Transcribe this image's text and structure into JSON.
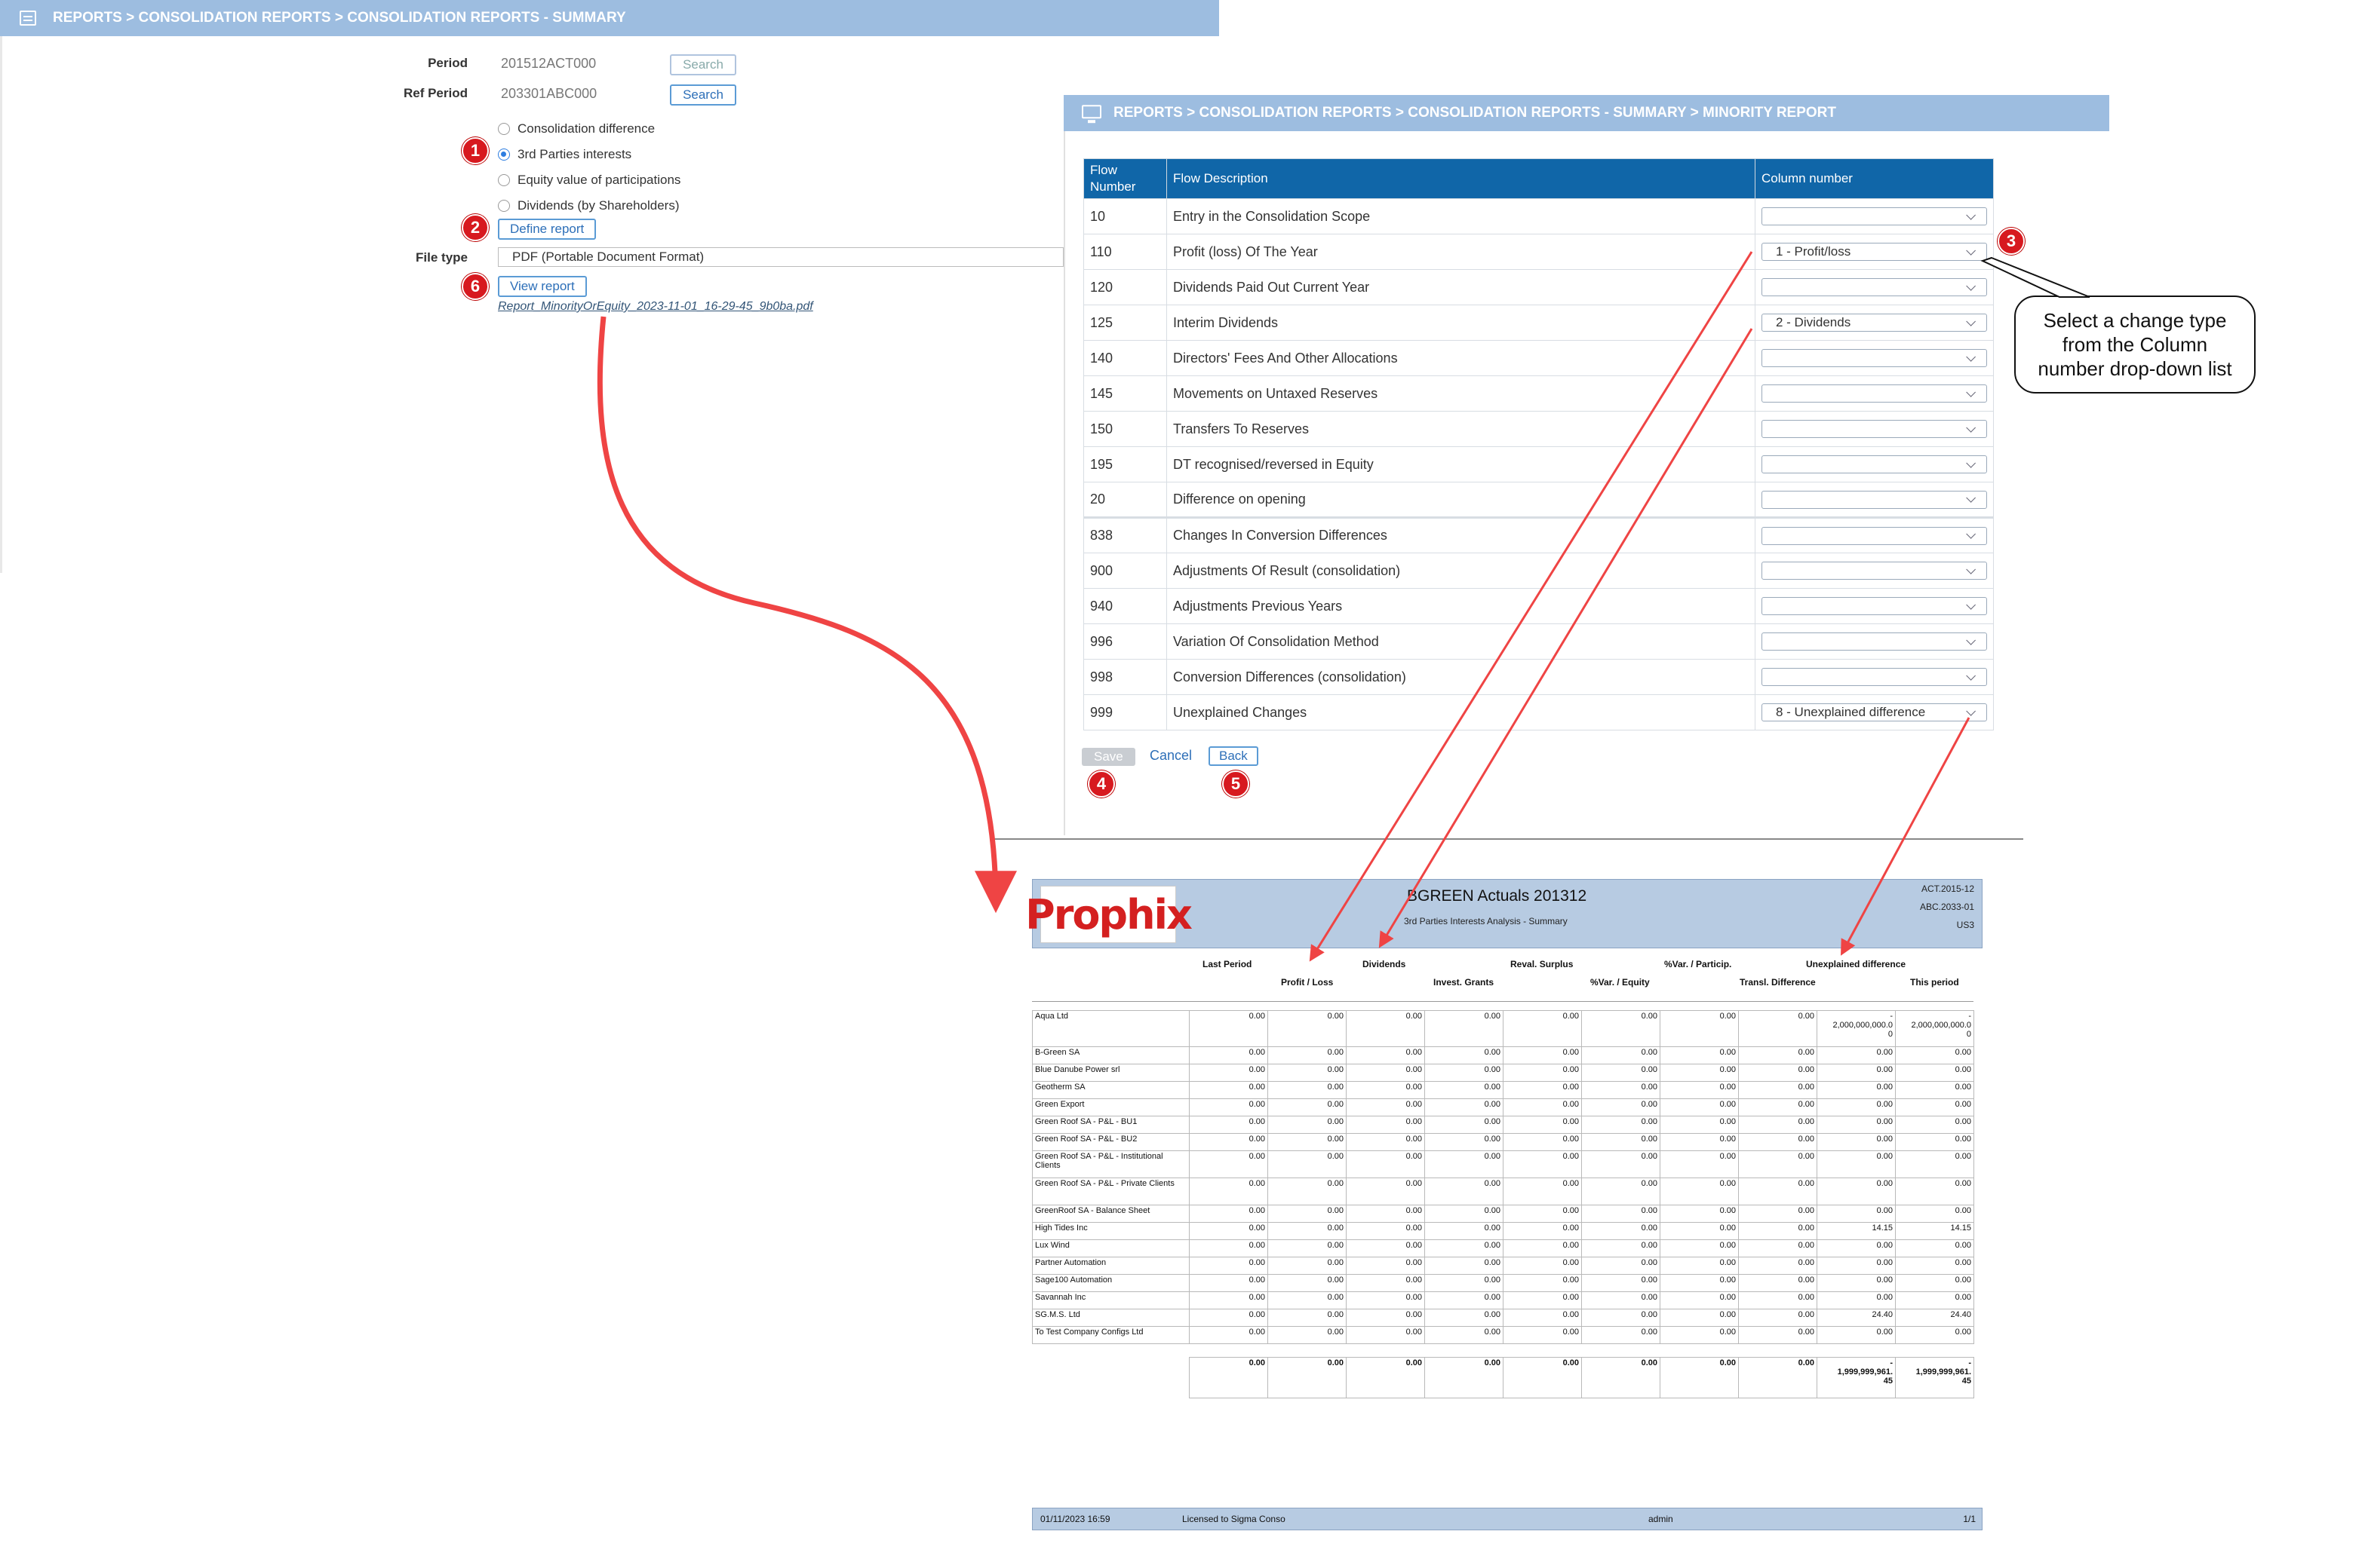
{
  "left_panel": {
    "breadcrumb": "REPORTS > CONSOLIDATION REPORTS > CONSOLIDATION REPORTS - SUMMARY",
    "period_label": "Period",
    "period_value": "201512ACT000",
    "ref_period_label": "Ref Period",
    "ref_period_value": "203301ABC000",
    "search_label": "Search",
    "report_types": [
      {
        "label": "Consolidation difference",
        "selected": false
      },
      {
        "label": "3rd Parties interests",
        "selected": true
      },
      {
        "label": "Equity value of participations",
        "selected": false
      },
      {
        "label": "Dividends (by Shareholders)",
        "selected": false
      }
    ],
    "define_report_label": "Define report",
    "file_type_label": "File type",
    "file_type_value": "PDF (Portable Document Format)",
    "view_report_label": "View report",
    "file_link": "Report_MinorityOrEquity_2023-11-01_16-29-45_9b0ba.pdf"
  },
  "badges": [
    "1",
    "2",
    "6",
    "3",
    "4",
    "5"
  ],
  "minority_report": {
    "breadcrumb": "REPORTS > CONSOLIDATION REPORTS > CONSOLIDATION REPORTS - SUMMARY > MINORITY REPORT",
    "columns": [
      "Flow Number",
      "Flow Description",
      "Column number"
    ],
    "rows": [
      {
        "number": "10",
        "description": "Entry in the Consolidation Scope",
        "column": ""
      },
      {
        "number": "110",
        "description": "Profit (loss) Of The Year",
        "column": "1 - Profit/loss"
      },
      {
        "number": "120",
        "description": "Dividends Paid Out Current Year",
        "column": ""
      },
      {
        "number": "125",
        "description": "Interim Dividends",
        "column": "2 - Dividends"
      },
      {
        "number": "140",
        "description": "Directors' Fees And Other Allocations",
        "column": ""
      },
      {
        "number": "145",
        "description": "Movements on Untaxed Reserves",
        "column": ""
      },
      {
        "number": "150",
        "description": "Transfers To Reserves",
        "column": ""
      },
      {
        "number": "195",
        "description": "DT recognised/reversed in Equity",
        "column": ""
      },
      {
        "number": "20",
        "description": "Difference on opening",
        "column": ""
      },
      {
        "number": "838",
        "description": "Changes In Conversion Differences",
        "column": ""
      },
      {
        "number": "900",
        "description": "Adjustments Of Result (consolidation)",
        "column": ""
      },
      {
        "number": "940",
        "description": "Adjustments Previous Years",
        "column": ""
      },
      {
        "number": "996",
        "description": "Variation Of Consolidation Method",
        "column": ""
      },
      {
        "number": "998",
        "description": "Conversion Differences (consolidation)",
        "column": ""
      },
      {
        "number": "999",
        "description": "Unexplained Changes",
        "column": "8 - Unexplained difference"
      }
    ],
    "save_label": "Save",
    "cancel_label": "Cancel",
    "back_label": "Back"
  },
  "callout": {
    "line1": "Select a change type",
    "line2": "from the Column",
    "line3": "number drop-down list"
  },
  "pdf": {
    "logo_text": "Prophix",
    "title": "BGREEN Actuals 201312",
    "subtitle": "3rd Parties Interests Analysis - Summary",
    "meta": [
      "ACT.2015-12",
      "ABC.2033-01",
      "US3"
    ],
    "col_headers_top": [
      "Last Period",
      "Dividends",
      "Reval. Surplus",
      "%Var. / Particip.",
      "Unexplained difference"
    ],
    "col_headers_bottom": [
      "Profit / Loss",
      "Invest. Grants",
      "%Var. / Equity",
      "Transl. Difference",
      "This period"
    ],
    "rows": [
      {
        "name": "Aqua Ltd",
        "values": [
          "0.00",
          "0.00",
          "0.00",
          "0.00",
          "0.00",
          "0.00",
          "0.00",
          "0.00",
          "-\n2,000,000,000.0\n0",
          "-\n2,000,000,000.0\n0"
        ]
      },
      {
        "name": "B-Green SA",
        "values": [
          "0.00",
          "0.00",
          "0.00",
          "0.00",
          "0.00",
          "0.00",
          "0.00",
          "0.00",
          "0.00",
          "0.00"
        ]
      },
      {
        "name": "Blue Danube Power srl",
        "values": [
          "0.00",
          "0.00",
          "0.00",
          "0.00",
          "0.00",
          "0.00",
          "0.00",
          "0.00",
          "0.00",
          "0.00"
        ]
      },
      {
        "name": "Geotherm SA",
        "values": [
          "0.00",
          "0.00",
          "0.00",
          "0.00",
          "0.00",
          "0.00",
          "0.00",
          "0.00",
          "0.00",
          "0.00"
        ]
      },
      {
        "name": "Green Export",
        "values": [
          "0.00",
          "0.00",
          "0.00",
          "0.00",
          "0.00",
          "0.00",
          "0.00",
          "0.00",
          "0.00",
          "0.00"
        ]
      },
      {
        "name": "Green Roof SA - P&L - BU1",
        "values": [
          "0.00",
          "0.00",
          "0.00",
          "0.00",
          "0.00",
          "0.00",
          "0.00",
          "0.00",
          "0.00",
          "0.00"
        ]
      },
      {
        "name": "Green Roof SA - P&L - BU2",
        "values": [
          "0.00",
          "0.00",
          "0.00",
          "0.00",
          "0.00",
          "0.00",
          "0.00",
          "0.00",
          "0.00",
          "0.00"
        ]
      },
      {
        "name": "Green Roof SA - P&L - Institutional Clients",
        "values": [
          "0.00",
          "0.00",
          "0.00",
          "0.00",
          "0.00",
          "0.00",
          "0.00",
          "0.00",
          "0.00",
          "0.00"
        ]
      },
      {
        "name": "Green Roof SA - P&L - Private Clients",
        "values": [
          "0.00",
          "0.00",
          "0.00",
          "0.00",
          "0.00",
          "0.00",
          "0.00",
          "0.00",
          "0.00",
          "0.00"
        ]
      },
      {
        "name": "GreenRoof SA - Balance Sheet",
        "values": [
          "0.00",
          "0.00",
          "0.00",
          "0.00",
          "0.00",
          "0.00",
          "0.00",
          "0.00",
          "0.00",
          "0.00"
        ]
      },
      {
        "name": "High Tides Inc",
        "values": [
          "0.00",
          "0.00",
          "0.00",
          "0.00",
          "0.00",
          "0.00",
          "0.00",
          "0.00",
          "14.15",
          "14.15"
        ]
      },
      {
        "name": "Lux Wind",
        "values": [
          "0.00",
          "0.00",
          "0.00",
          "0.00",
          "0.00",
          "0.00",
          "0.00",
          "0.00",
          "0.00",
          "0.00"
        ]
      },
      {
        "name": "Partner Automation",
        "values": [
          "0.00",
          "0.00",
          "0.00",
          "0.00",
          "0.00",
          "0.00",
          "0.00",
          "0.00",
          "0.00",
          "0.00"
        ]
      },
      {
        "name": "Sage100 Automation",
        "values": [
          "0.00",
          "0.00",
          "0.00",
          "0.00",
          "0.00",
          "0.00",
          "0.00",
          "0.00",
          "0.00",
          "0.00"
        ]
      },
      {
        "name": "Savannah Inc",
        "values": [
          "0.00",
          "0.00",
          "0.00",
          "0.00",
          "0.00",
          "0.00",
          "0.00",
          "0.00",
          "0.00",
          "0.00"
        ]
      },
      {
        "name": "SG.M.S. Ltd",
        "values": [
          "0.00",
          "0.00",
          "0.00",
          "0.00",
          "0.00",
          "0.00",
          "0.00",
          "0.00",
          "24.40",
          "24.40"
        ]
      },
      {
        "name": "To Test Company Configs Ltd",
        "values": [
          "0.00",
          "0.00",
          "0.00",
          "0.00",
          "0.00",
          "0.00",
          "0.00",
          "0.00",
          "0.00",
          "0.00"
        ]
      }
    ],
    "totals": [
      "0.00",
      "0.00",
      "0.00",
      "0.00",
      "0.00",
      "0.00",
      "0.00",
      "0.00",
      "-\n1,999,999,961.\n45",
      "-\n1,999,999,961.\n45"
    ],
    "footer": {
      "date": "01/11/2023 16:59",
      "license": "Licensed to Sigma Conso",
      "user": "admin",
      "page": "1/1"
    }
  },
  "colors": {
    "header_bg": "#9dbde0",
    "table_header": "#1066a8",
    "badge": "#d7191f",
    "arrow": "#ef4444",
    "link": "#2d6fb8"
  }
}
